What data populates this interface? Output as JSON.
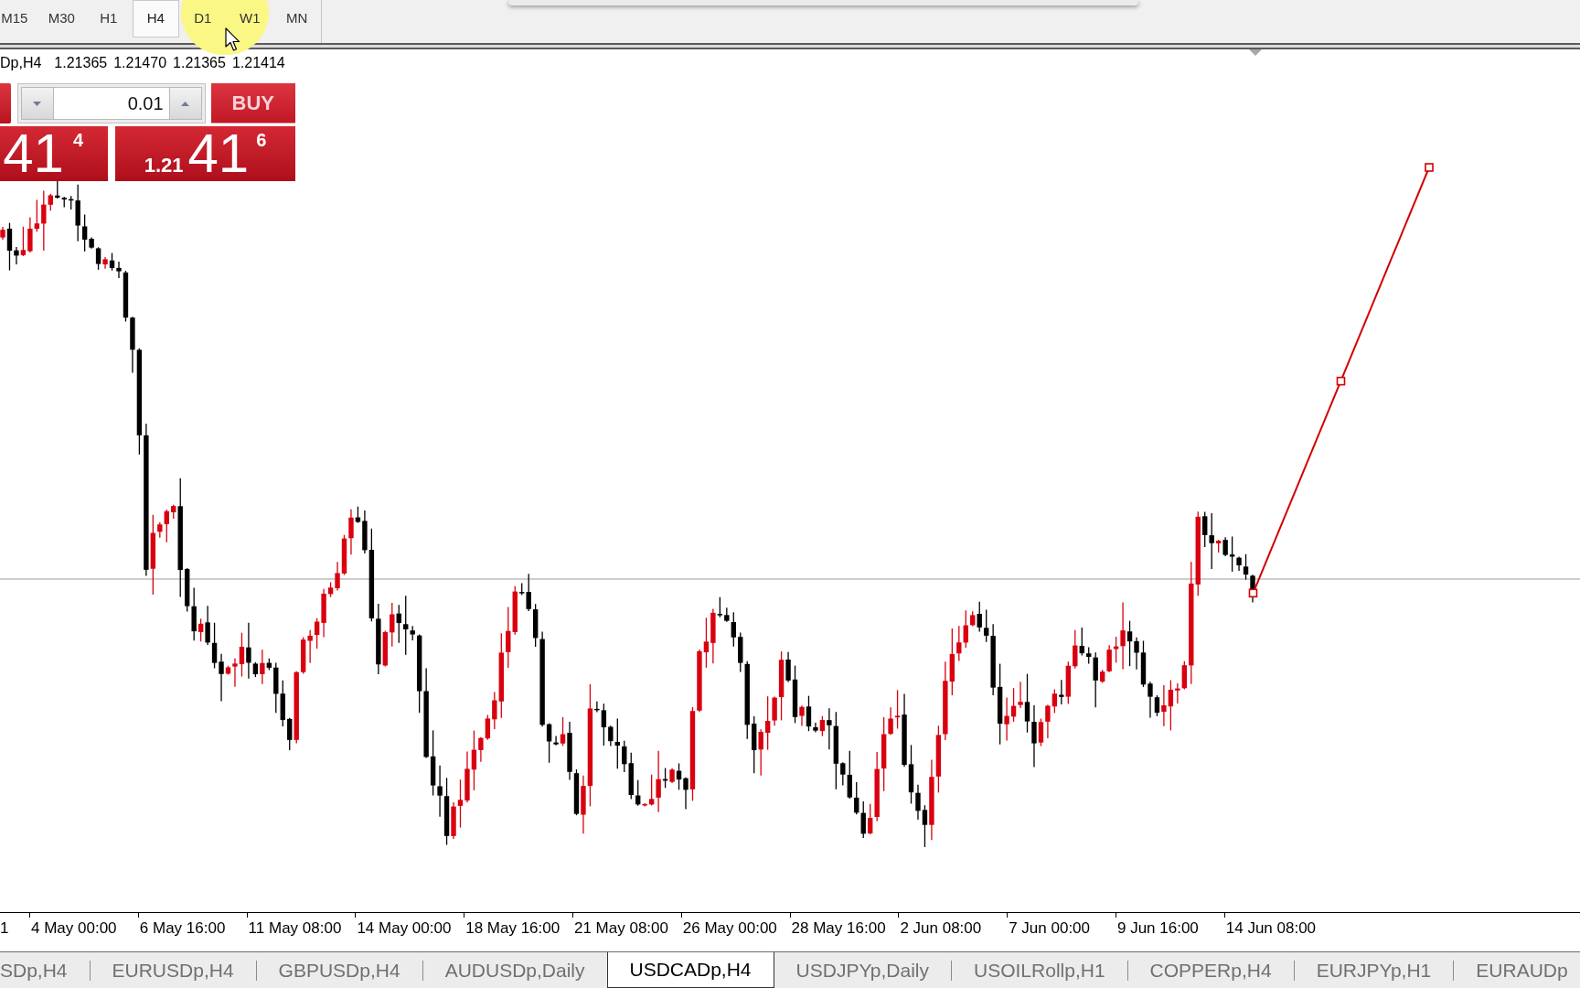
{
  "toolbar": {
    "timeframes": [
      {
        "label": "M15",
        "selected": false
      },
      {
        "label": "M30",
        "selected": false
      },
      {
        "label": "H1",
        "selected": false
      },
      {
        "label": "H4",
        "selected": true
      },
      {
        "label": "D1",
        "selected": false
      },
      {
        "label": "W1",
        "selected": false
      },
      {
        "label": "MN",
        "selected": false
      }
    ]
  },
  "chart": {
    "symbol": "Dp,H4",
    "ohlc": [
      "1.21365",
      "1.21470",
      "1.21365",
      "1.21414"
    ]
  },
  "trade_panel": {
    "lot": "0.01",
    "buy_label": "BUY",
    "sell_price": {
      "pips": "41",
      "fraction": "4"
    },
    "buy_price": {
      "prefix": "1.21",
      "pips": "41",
      "fraction": "6"
    }
  },
  "x_axis": {
    "labels": [
      "1",
      "4 May 00:00",
      "6 May 16:00",
      "11 May 08:00",
      "14 May 00:00",
      "18 May 16:00",
      "21 May 08:00",
      "26 May 00:00",
      "28 May 16:00",
      "2 Jun 08:00",
      "7 Jun 00:00",
      "9 Jun 16:00",
      "14 Jun 08:00"
    ]
  },
  "tabs": [
    {
      "label": "SDp,H4",
      "selected": false
    },
    {
      "label": "EURUSDp,H4",
      "selected": false
    },
    {
      "label": "GBPUSDp,H4",
      "selected": false
    },
    {
      "label": "AUDUSDp,Daily",
      "selected": false
    },
    {
      "label": "USDCADp,H4",
      "selected": true
    },
    {
      "label": "USDJPYp,Daily",
      "selected": false
    },
    {
      "label": "USOILRollp,H1",
      "selected": false
    },
    {
      "label": "COPPERp,H4",
      "selected": false
    },
    {
      "label": "EURJPYp,H1",
      "selected": false
    },
    {
      "label": "EURAUDp",
      "selected": false
    }
  ]
}
